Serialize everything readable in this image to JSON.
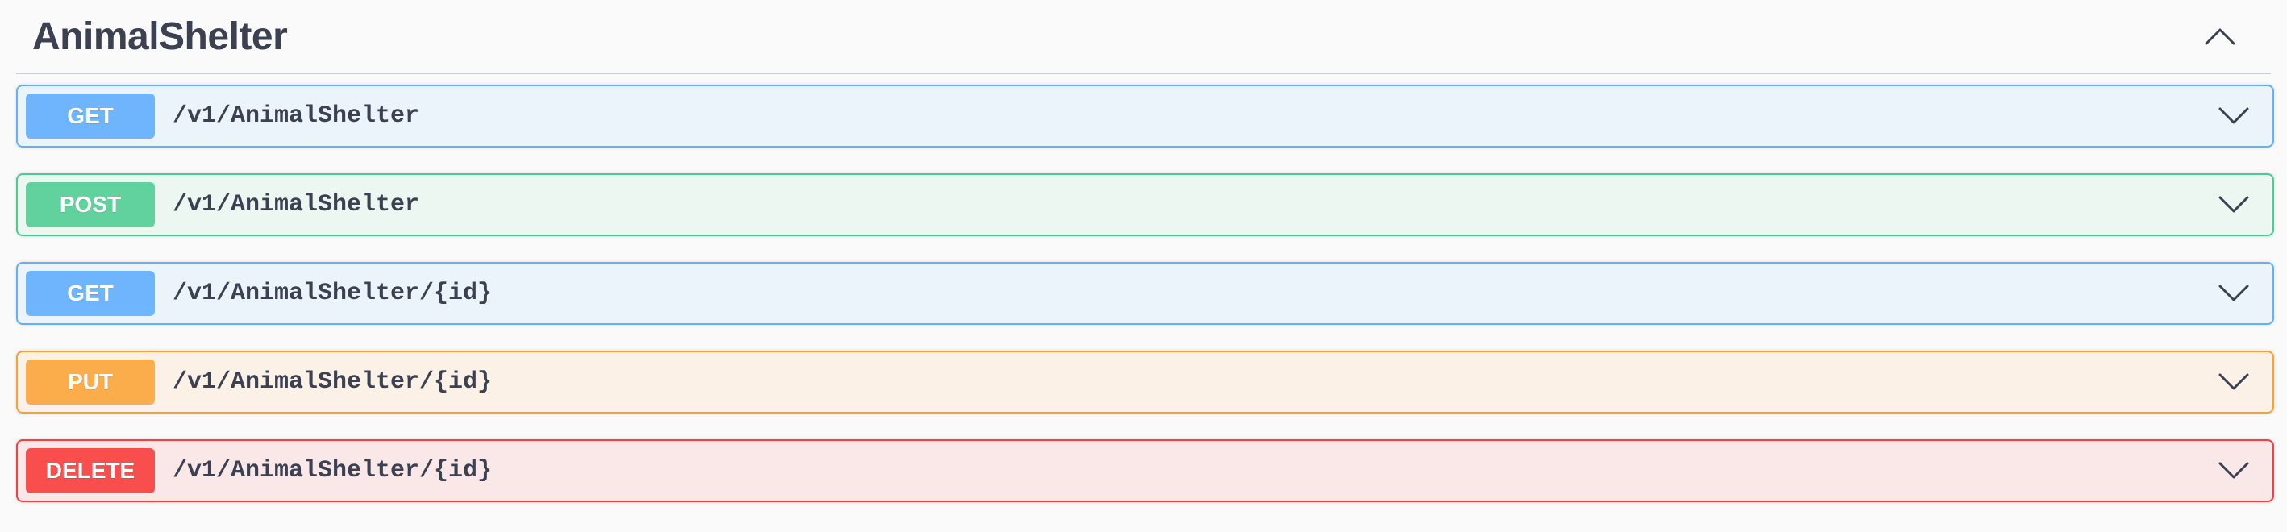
{
  "section": {
    "title": "AnimalShelter",
    "collapse_icon": "chevron-up-icon"
  },
  "operations": [
    {
      "method": "GET",
      "path": "/v1/AnimalShelter",
      "color": "#61affe",
      "expand_icon": "chevron-down-icon"
    },
    {
      "method": "POST",
      "path": "/v1/AnimalShelter",
      "color": "#49cc90",
      "expand_icon": "chevron-down-icon"
    },
    {
      "method": "GET",
      "path": "/v1/AnimalShelter/{id}",
      "color": "#61affe",
      "expand_icon": "chevron-down-icon"
    },
    {
      "method": "PUT",
      "path": "/v1/AnimalShelter/{id}",
      "color": "#fca130",
      "expand_icon": "chevron-down-icon"
    },
    {
      "method": "DELETE",
      "path": "/v1/AnimalShelter/{id}",
      "color": "#f93e3e",
      "expand_icon": "chevron-down-icon"
    }
  ]
}
